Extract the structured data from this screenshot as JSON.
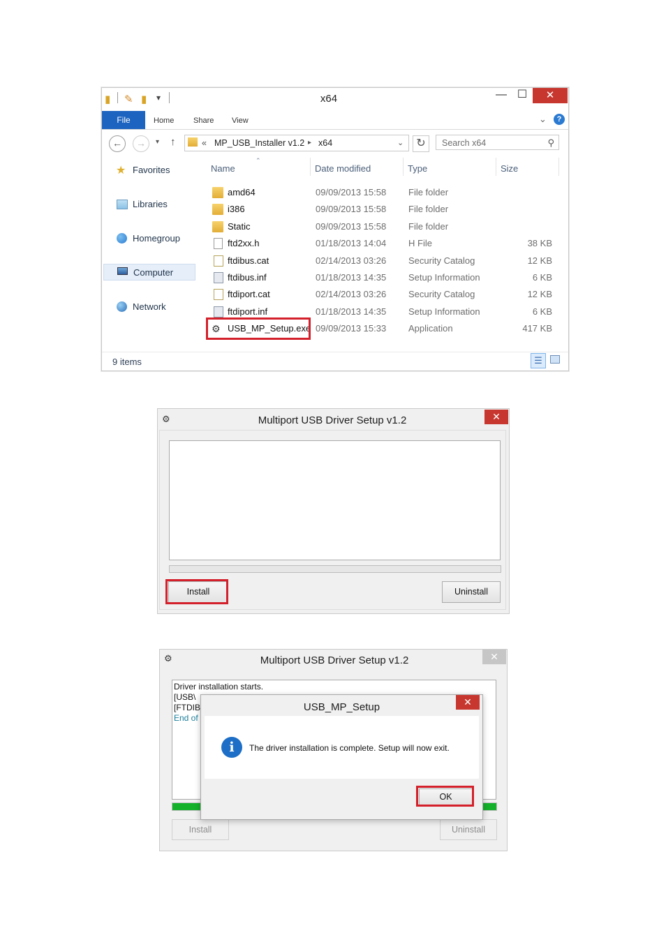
{
  "explorer": {
    "title": "x64",
    "minimize_glyph": "—",
    "maximize_glyph": "☐",
    "close_glyph": "✕",
    "ribbon_tabs": [
      "File",
      "Home",
      "Share",
      "View"
    ],
    "breadcrumb": {
      "chevron": "«",
      "parent": "MP_USB_Installer v1.2",
      "separator": "▸",
      "current": "x64"
    },
    "search_placeholder": "Search x64",
    "nav_pane": [
      "Favorites",
      "Libraries",
      "Homegroup",
      "Computer",
      "Network"
    ],
    "columns": [
      "Name",
      "Date modified",
      "Type",
      "Size"
    ],
    "files": [
      {
        "name": "amd64",
        "date": "09/09/2013 15:58",
        "type": "File folder",
        "size": "",
        "icon": "folder-icon"
      },
      {
        "name": "i386",
        "date": "09/09/2013 15:58",
        "type": "File folder",
        "size": "",
        "icon": "folder-icon"
      },
      {
        "name": "Static",
        "date": "09/09/2013 15:58",
        "type": "File folder",
        "size": "",
        "icon": "folder-icon"
      },
      {
        "name": "ftd2xx.h",
        "date": "01/18/2013 14:04",
        "type": "H File",
        "size": "38 KB",
        "icon": "document-icon"
      },
      {
        "name": "ftdibus.cat",
        "date": "02/14/2013 03:26",
        "type": "Security Catalog",
        "size": "12 KB",
        "icon": "security-catalog-icon"
      },
      {
        "name": "ftdibus.inf",
        "date": "01/18/2013 14:35",
        "type": "Setup Information",
        "size": "6 KB",
        "icon": "setup-information-icon"
      },
      {
        "name": "ftdiport.cat",
        "date": "02/14/2013 03:26",
        "type": "Security Catalog",
        "size": "12 KB",
        "icon": "security-catalog-icon"
      },
      {
        "name": "ftdiport.inf",
        "date": "01/18/2013 14:35",
        "type": "Setup Information",
        "size": "6 KB",
        "icon": "setup-information-icon"
      },
      {
        "name": "USB_MP_Setup.exe",
        "date": "09/09/2013 15:33",
        "type": "Application",
        "size": "417 KB",
        "icon": "application-icon"
      }
    ],
    "status": "9 items"
  },
  "setup1": {
    "title": "Multiport USB Driver Setup v1.2",
    "close_glyph": "✕",
    "install_label": "Install",
    "uninstall_label": "Uninstall",
    "progress": 0
  },
  "setup2": {
    "title": "Multiport USB Driver Setup v1.2",
    "close_glyph": "✕",
    "log_lines": [
      "Driver installation starts.",
      "[USB\\",
      "[FTDIB",
      "End of"
    ],
    "install_label": "Install",
    "uninstall_label": "Uninstall",
    "progress": 1.0
  },
  "msgbox": {
    "title": "USB_MP_Setup",
    "close_glyph": "✕",
    "icon_glyph": "i",
    "message": "The driver installation is complete. Setup will now exit.",
    "ok_label": "OK"
  },
  "colors": {
    "highlight": "#d3202a",
    "file_tab": "#1c64c0",
    "close": "#c7372f",
    "progress_fill": "#13b12a",
    "info": "#1d6ec6"
  }
}
